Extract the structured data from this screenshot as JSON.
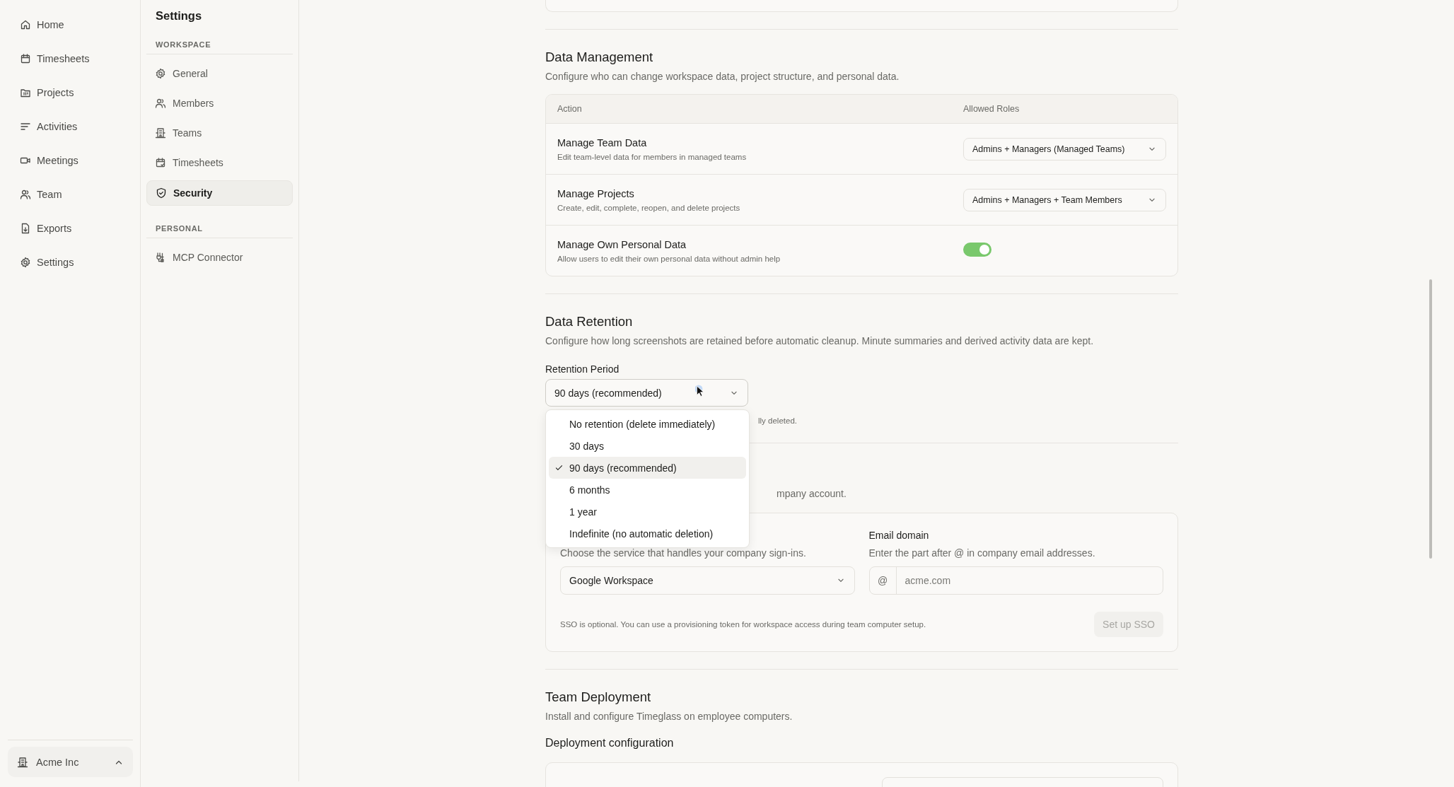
{
  "nav": {
    "items": [
      {
        "label": "Home"
      },
      {
        "label": "Timesheets"
      },
      {
        "label": "Projects"
      },
      {
        "label": "Activities"
      },
      {
        "label": "Meetings"
      },
      {
        "label": "Team"
      },
      {
        "label": "Exports"
      },
      {
        "label": "Settings"
      }
    ]
  },
  "workspace_switcher": {
    "name": "Acme Inc"
  },
  "settings_panel": {
    "title": "Settings",
    "sections": [
      {
        "label": "WORKSPACE",
        "items": [
          {
            "label": "General",
            "selected": false
          },
          {
            "label": "Members",
            "selected": false
          },
          {
            "label": "Teams",
            "selected": false
          },
          {
            "label": "Timesheets",
            "selected": false
          },
          {
            "label": "Security",
            "selected": true
          }
        ]
      },
      {
        "label": "PERSONAL",
        "items": [
          {
            "label": "MCP Connector",
            "selected": false
          }
        ]
      }
    ]
  },
  "data_management": {
    "title": "Data Management",
    "description": "Configure who can change workspace data, project structure, and personal data.",
    "columns": [
      "Action",
      "Allowed Roles"
    ],
    "rows": [
      {
        "kind": "select",
        "title": "Manage Team Data",
        "description": "Edit team-level data for members in managed teams",
        "value": "Admins + Managers (Managed Teams)"
      },
      {
        "kind": "select",
        "title": "Manage Projects",
        "description": "Create, edit, complete, reopen, and delete projects",
        "value": "Admins + Managers + Team Members"
      },
      {
        "kind": "toggle",
        "title": "Manage Own Personal Data",
        "description": "Allow users to edit their own personal data without admin help",
        "on": true
      }
    ]
  },
  "data_retention": {
    "title": "Data Retention",
    "description": "Configure how long screenshots are retained before automatic cleanup. Minute summaries and derived activity data are kept.",
    "field_label": "Retention Period",
    "value": "90 days (recommended)",
    "hint": "lly deleted.",
    "options": [
      {
        "label": "No retention (delete immediately)",
        "selected": false
      },
      {
        "label": "30 days",
        "selected": false
      },
      {
        "label": "90 days (recommended)",
        "selected": true
      },
      {
        "label": "6 months",
        "selected": false
      },
      {
        "label": "1 year",
        "selected": false
      },
      {
        "label": "Indefinite (no automatic deletion)",
        "selected": false
      }
    ]
  },
  "sso": {
    "description": "mpany account.",
    "provider_hint": "Choose the service that handles your company sign-ins.",
    "provider_value": "Google Workspace",
    "email_label": "Email domain",
    "email_hint": "Enter the part after @ in company email addresses.",
    "email_prefix": "@",
    "email_placeholder": "acme.com",
    "note": "SSO is optional. You can use a provisioning token for workspace access during team computer setup.",
    "button": {
      "label": "Set up SSO",
      "disabled": true
    }
  },
  "team_deployment": {
    "title": "Team Deployment",
    "description": "Install and configure Timeglass on employee computers.",
    "subheading": "Deployment configuration"
  }
}
